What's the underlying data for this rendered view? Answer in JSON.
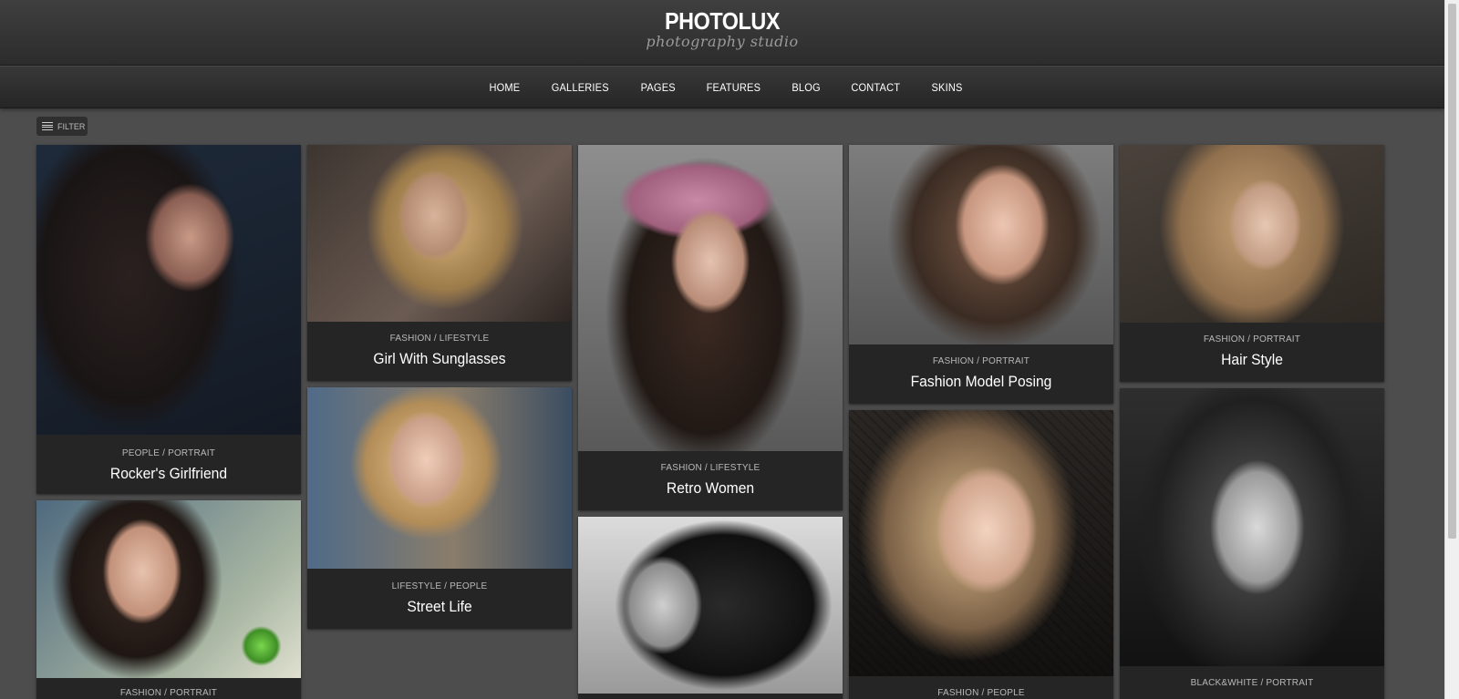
{
  "brand": {
    "title": "PHOTOLUX",
    "subtitle": "photography studio"
  },
  "nav": {
    "items": [
      {
        "label": "HOME"
      },
      {
        "label": "GALLERIES"
      },
      {
        "label": "PAGES"
      },
      {
        "label": "FEATURES"
      },
      {
        "label": "BLOG"
      },
      {
        "label": "CONTACT"
      },
      {
        "label": "SKINS"
      }
    ]
  },
  "filter": {
    "label": "FILTER",
    "icon": "menu-icon"
  },
  "gallery": {
    "items": [
      {
        "category": "PEOPLE / PORTRAIT",
        "title": "Rocker's Girlfriend"
      },
      {
        "category": "FASHION / LIFESTYLE",
        "title": "Girl With Sunglasses"
      },
      {
        "category": "FASHION / LIFESTYLE",
        "title": "Retro Women"
      },
      {
        "category": "FASHION / PORTRAIT",
        "title": "Fashion Model Posing"
      },
      {
        "category": "FASHION / PORTRAIT",
        "title": "Hair Style"
      },
      {
        "category": "LIFESTYLE / PEOPLE",
        "title": "Street Life"
      },
      {
        "category": "FASHION / PORTRAIT",
        "title": ""
      },
      {
        "category": "",
        "title": ""
      },
      {
        "category": "FASHION / PEOPLE",
        "title": ""
      },
      {
        "category": "BLACK&WHITE / PORTRAIT",
        "title": ""
      }
    ]
  },
  "colors": {
    "page_background": "#4d4d4d",
    "header_background": "#333333",
    "card_background": "#252525",
    "text_primary": "#ffffff",
    "text_secondary": "#b9b9b9"
  }
}
